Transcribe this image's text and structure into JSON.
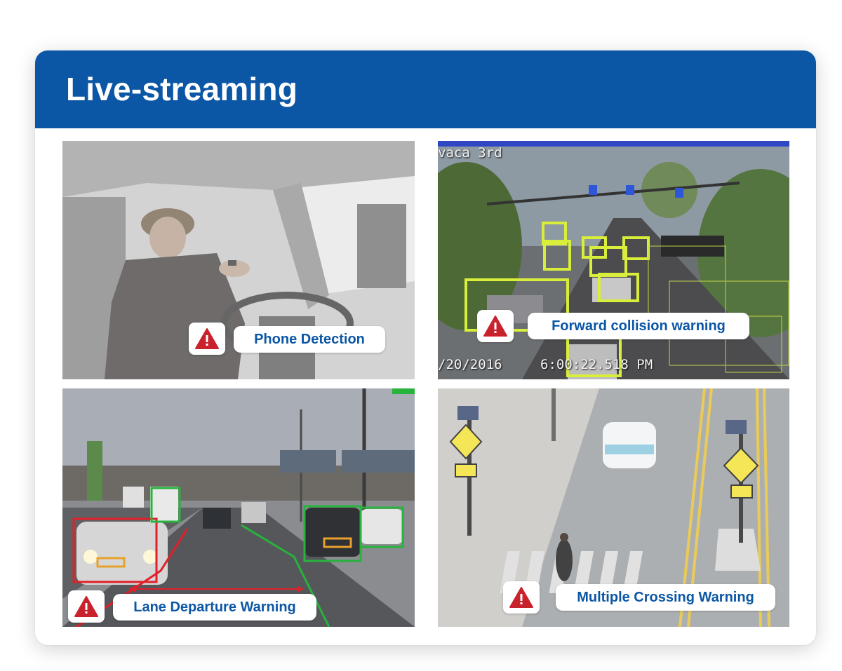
{
  "title": "Live-streaming",
  "panels": {
    "phone": {
      "label": "Phone Detection"
    },
    "collision": {
      "label": "Forward collision warning",
      "overlay_street": "vaca 3rd",
      "overlay_date": "/20/2016",
      "overlay_time": "6:00:22.518 PM"
    },
    "lane": {
      "label": "Lane Departure Warning"
    },
    "crossing": {
      "label": "Multiple Crossing Warning"
    }
  },
  "colors": {
    "header": "#0b56a5",
    "label_text": "#0b56a5",
    "alert_red": "#c8232c",
    "detection_yellow": "#d8ee3a",
    "detection_green": "#27b33c",
    "warning_red": "#e0202a"
  },
  "icons": [
    "warning-triangle-icon"
  ]
}
